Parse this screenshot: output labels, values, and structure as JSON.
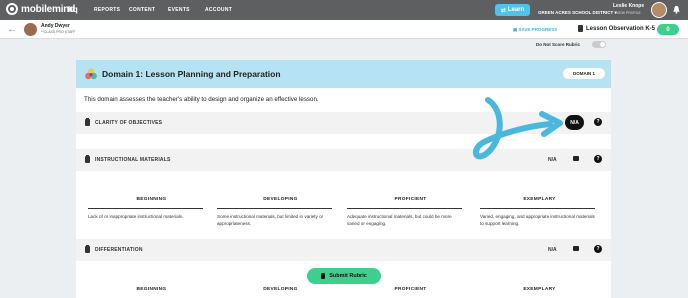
{
  "topnav": {
    "logo": "mobilemind",
    "hq": "hq",
    "links": [
      "REPORTS",
      "CONTENT",
      "EVENTS",
      "ACCOUNT"
    ],
    "learn_button": "Learn",
    "district": "GREEN ACRES SCHOOL DISTRICT",
    "user_name": "Leslie Knope",
    "view_profile": "VIEW PROFILE"
  },
  "subheader": {
    "name": "Andy Dwyer",
    "staff": "**CLASS PRO STAFF",
    "save_progress": "SAVE PROGRESS",
    "observation_title": "Lesson Observation K-5",
    "score": "0"
  },
  "no_score_label": "Do Not Score Rubric",
  "domain": {
    "title": "Domain 1: Lesson Planning and Preparation",
    "badge": "DOMAIN 1",
    "description": "This domain assesses the teacher's ability to design and organize an effective lesson."
  },
  "sections": [
    {
      "title": "CLARITY OF OBJECTIVES",
      "value": "N/A"
    },
    {
      "title": "INSTRUCTIONAL MATERIALS",
      "value": "N/A"
    },
    {
      "title": "DIFFERENTIATION",
      "value": "N/A"
    }
  ],
  "levels": [
    "BEGINNING",
    "DEVELOPING",
    "PROFICIENT",
    "EXEMPLARY"
  ],
  "materials_descriptions": [
    "Lack of or inappropriate instructional materials.",
    "Some instructional materials, but limited in variety or appropriateness.",
    "Adequate instructional materials, but could be more varied or engaging.",
    "Varied, engaging, and appropriate instructional materials to support learning."
  ],
  "submit_label": "Submit Rubric",
  "colors": {
    "accent": "#3ecf8e",
    "header": "#b6e3f3",
    "nav": "#5d5f61",
    "arrow": "#4ab8dc"
  }
}
